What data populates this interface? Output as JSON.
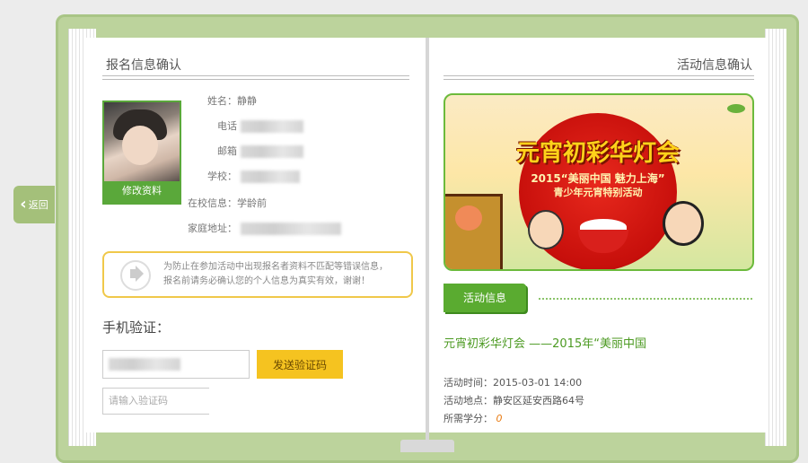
{
  "nav": {
    "back_label": "返回"
  },
  "left": {
    "section_title": "报名信息确认",
    "edit_label": "修改资料",
    "fields": [
      {
        "label": "姓名：",
        "value": "静静"
      },
      {
        "label": "电话",
        "value": ""
      },
      {
        "label": "邮箱",
        "value": ""
      },
      {
        "label": "学校：",
        "value": ""
      },
      {
        "label": "在校信息：",
        "value": "学龄前"
      },
      {
        "label": "家庭地址：",
        "value": ""
      }
    ],
    "notice_line1": "为防止在参加活动中出现报名者资料不匹配等错误信息，",
    "notice_line2": "报名前请务必确认您的个人信息为真实有效，谢谢！",
    "phone_title": "手机验证：",
    "send_code_label": "发送验证码",
    "code_placeholder": "请输入验证码"
  },
  "right": {
    "section_title": "活动信息确认",
    "banner": {
      "title": "元宵初彩华灯会",
      "sub1": "2015“美丽中国 魅力上海”",
      "sub2": "青少年元宵特别活动"
    },
    "tag_label": "活动信息",
    "activity_title": "元宵初彩华灯会 ——2015年“美丽中国",
    "time_label": "活动时间：",
    "time_value": "2015-03-01 14:00",
    "place_label": "活动地点：",
    "place_value": "静安区延安西路64号",
    "credit_label": "所需学分：",
    "credit_value": "0"
  },
  "colors": {
    "accent_green": "#5aab30",
    "cover_green": "#bcd39c",
    "button_yellow": "#f5c320",
    "credit_orange": "#e8790f"
  }
}
